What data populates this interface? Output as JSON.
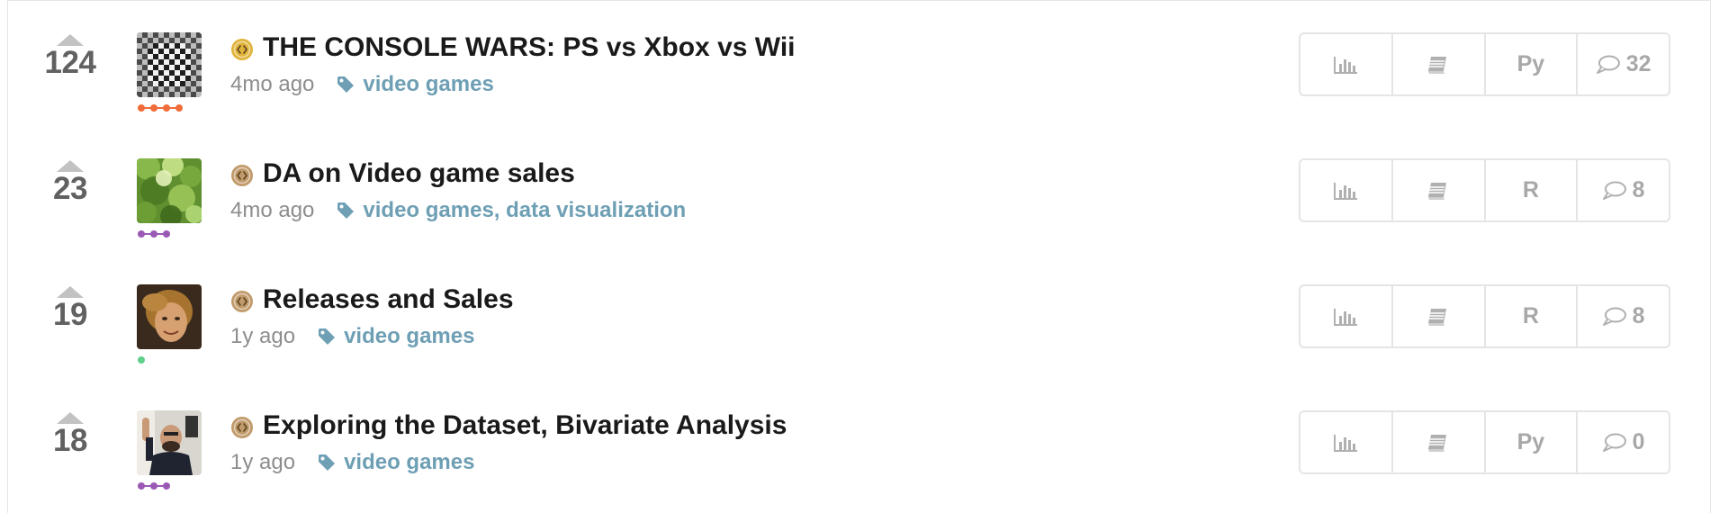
{
  "kernels": [
    {
      "votes": "124",
      "title": "THE CONSOLE WARS: PS vs Xbox vs Wii",
      "age": "4mo ago",
      "tags": "video games",
      "language": "Py",
      "comments": "32",
      "medal_color": "#e0b33b",
      "tier_color": "#f06c3a",
      "tier_dots": 4,
      "avatar": "checker-pattern"
    },
    {
      "votes": "23",
      "title": "DA on Video game sales",
      "age": "4mo ago",
      "tags": "video games, data visualization",
      "language": "R",
      "comments": "8",
      "medal_color": "#c19a6b",
      "tier_color": "#9b59b6",
      "tier_dots": 3,
      "avatar": "green-foliage"
    },
    {
      "votes": "19",
      "title": "Releases and Sales",
      "age": "1y ago",
      "tags": "video games",
      "language": "R",
      "comments": "8",
      "medal_color": "#c19a6b",
      "tier_color": "#5fd18a",
      "tier_dots": 1,
      "avatar": "person-portrait"
    },
    {
      "votes": "18",
      "title": "Exploring the Dataset, Bivariate Analysis",
      "age": "1y ago",
      "tags": "video games",
      "language": "Py",
      "comments": "0",
      "medal_color": "#c19a6b",
      "tier_color": "#9b59b6",
      "tier_dots": 3,
      "avatar": "person-waving"
    }
  ],
  "icons": {
    "upvote": "triangle-up-icon",
    "tag": "tag-icon",
    "chart": "bar-chart-icon",
    "notebook": "notebook-icon",
    "comment": "speech-bubble-icon",
    "medal": "medal-icon"
  }
}
